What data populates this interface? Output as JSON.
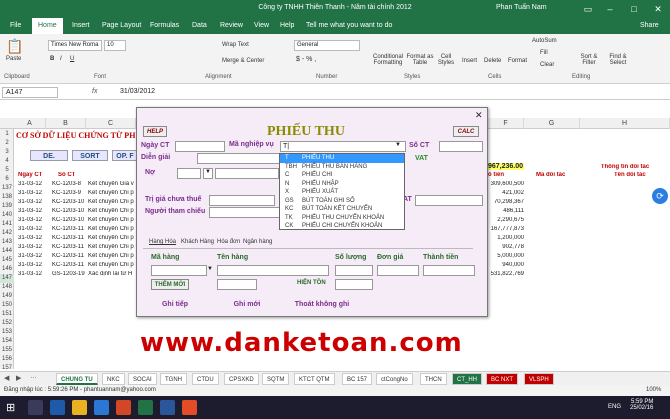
{
  "app": {
    "title": "Công ty TNHH Thiên Thanh - Năm tài chính 2012",
    "user": "Phan Tuấn Nam",
    "share": "Share"
  },
  "ribbon_tabs": [
    "File",
    "Home",
    "Insert",
    "Page Layout",
    "Formulas",
    "Data",
    "Review",
    "View",
    "Help",
    "Tell me what you want to do"
  ],
  "ribbon": {
    "paste": "Paste",
    "clipboard": "Clipboard",
    "font_name": "Times New Roma",
    "font_size": "10",
    "font": "Font",
    "wrap_text": "Wrap Text",
    "merge_center": "Merge & Center",
    "alignment": "Alignment",
    "number_format": "General",
    "number": "Number",
    "conditional": "Conditional Formatting",
    "format_as_table": "Format as Table",
    "cell_styles": "Cell Styles",
    "styles": "Styles",
    "insert": "Insert",
    "delete": "Delete",
    "format": "Format",
    "cells": "Cells",
    "autosum": "AutoSum",
    "fill": "Fill",
    "clear": "Clear",
    "sort_filter": "Sort & Filter",
    "find_select": "Find & Select",
    "editing": "Editing"
  },
  "formula": {
    "name_box": "A147",
    "value": "31/03/2012"
  },
  "columns": [
    "A",
    "B",
    "C",
    "D",
    "E",
    "F",
    "G",
    "H"
  ],
  "rows": [
    "1",
    "2",
    "3",
    "4",
    "5",
    "6",
    "137",
    "138",
    "139",
    "140",
    "141",
    "142",
    "143",
    "144",
    "145",
    "146",
    "147",
    "148",
    "149",
    "150",
    "151",
    "152",
    "153",
    "154",
    "155",
    "156",
    "157"
  ],
  "sheet": {
    "title": "CƠ SỞ DỮ LIỆU CHỨNG TỪ PH",
    "btn_de": "DE.",
    "btn_sort": "SORT",
    "btn_op": "OP. F",
    "col_ngay": "Ngày CT",
    "col_so": "Số CT",
    "col_tien": "ố tiền",
    "col_ma": "Mã đối tác",
    "col_ten": "Tên đối tác",
    "info": "Thông tin đối tác",
    "total": "967,236.00"
  },
  "table_rows": [
    {
      "d": "31-03-12",
      "s": "KC-1203-8",
      "t": "Kết chuyển Giá v",
      "v": "309,600,500"
    },
    {
      "d": "31-03-12",
      "s": "KC-1203-9",
      "t": "Kết chuyển Chi p",
      "v": "421,002"
    },
    {
      "d": "31-03-12",
      "s": "KC-1203-10",
      "t": "Kết chuyển Chi p",
      "v": "70,298,367"
    },
    {
      "d": "31-03-12",
      "s": "KC-1203-10",
      "t": "Kết chuyển Chi p",
      "v": "486,111"
    },
    {
      "d": "31-03-12",
      "s": "KC-1203-10",
      "t": "Kết chuyển Chi p",
      "v": "2,290,675"
    },
    {
      "d": "31-03-12",
      "s": "KC-1203-11",
      "t": "Kết chuyển Chi p",
      "v": "167,777,873"
    },
    {
      "d": "31-03-12",
      "s": "KC-1203-11",
      "t": "Kết chuyển Chi p",
      "v": "1,200,000"
    },
    {
      "d": "31-03-12",
      "s": "KC-1203-11",
      "t": "Kết chuyển Chi p",
      "v": "902,778"
    },
    {
      "d": "31-03-12",
      "s": "KC-1203-11",
      "t": "Kết chuyển Chi p",
      "v": "5,000,000"
    },
    {
      "d": "31-03-12",
      "s": "KC-1203-11",
      "t": "Kết chuyển Chi p",
      "v": "940,000"
    },
    {
      "d": "31-03-12",
      "s": "GS-1203-19",
      "t": "Xác định lãi từ H",
      "v": "531,822,769"
    }
  ],
  "dialog": {
    "title": "PHIẾU THU",
    "help": "HELP",
    "calc": "CALC",
    "close": "✕",
    "ngay_ct": "Ngày CT",
    "ma_nghiep_vu": "Mã nghiệp vụ",
    "ma_value": "T|",
    "so_ct": "Số CT",
    "dien_giai": "Diễn giải",
    "no": "Nợ",
    "vat": "VAT",
    "tri_gia": "Trị giá chưa thuế",
    "nguoi_tham_chieu": "Người tham chiếu",
    "at": "AT",
    "tabs": [
      "Hàng Hóa",
      "Khách Hàng",
      "Hóa đơn",
      "Ngân hàng"
    ],
    "ma_hang": "Mã hàng",
    "ten_hang": "Tên hàng",
    "so_luong": "Số lượng",
    "don_gia": "Đơn giá",
    "thanh_tien": "Thành tiền",
    "them_moi": "THÊM MỚI",
    "hien_ton": "HIỆN TỒN",
    "ghi_tiep": "Ghi tiếp",
    "ghi_moi": "Ghi mới",
    "thoat": "Thoát không ghi"
  },
  "dropdown": [
    {
      "code": "T",
      "name": "PHIẾU THU"
    },
    {
      "code": "TBH",
      "name": "PHIẾU THU BÁN HÀNG"
    },
    {
      "code": "C",
      "name": "PHIẾU CHI"
    },
    {
      "code": "N",
      "name": "PHIẾU NHẬP"
    },
    {
      "code": "X",
      "name": "PHIẾU XUẤT"
    },
    {
      "code": "GS",
      "name": "BÚT TOÁN GHI SỔ"
    },
    {
      "code": "KC",
      "name": "BÚT TOÁN KẾT CHUYỂN"
    },
    {
      "code": "TK",
      "name": "PHIẾU THU CHUYỂN KHOẢN"
    },
    {
      "code": "CK",
      "name": "PHIẾU CHI CHUYỂN KHOẢN"
    }
  ],
  "watermark": "www.danketoan.com",
  "sheet_tabs": [
    "CHUNG TU",
    "NKC",
    "SOCAI",
    "TGNH",
    "CTDU",
    "CPSXKD",
    "SQTM",
    "KTCT QTM",
    "BC 157",
    "ctCongNo",
    "THCN",
    "CT_HH",
    "BC NXT",
    "VLSPH"
  ],
  "status": {
    "text": "Đăng nhập lúc : 5:59:26 PM  -  phantuannam@yahoo.com",
    "zoom": "100%"
  },
  "taskbar": {
    "lang": "ENG",
    "time": "5:59 PM",
    "date": "25/02/16"
  }
}
